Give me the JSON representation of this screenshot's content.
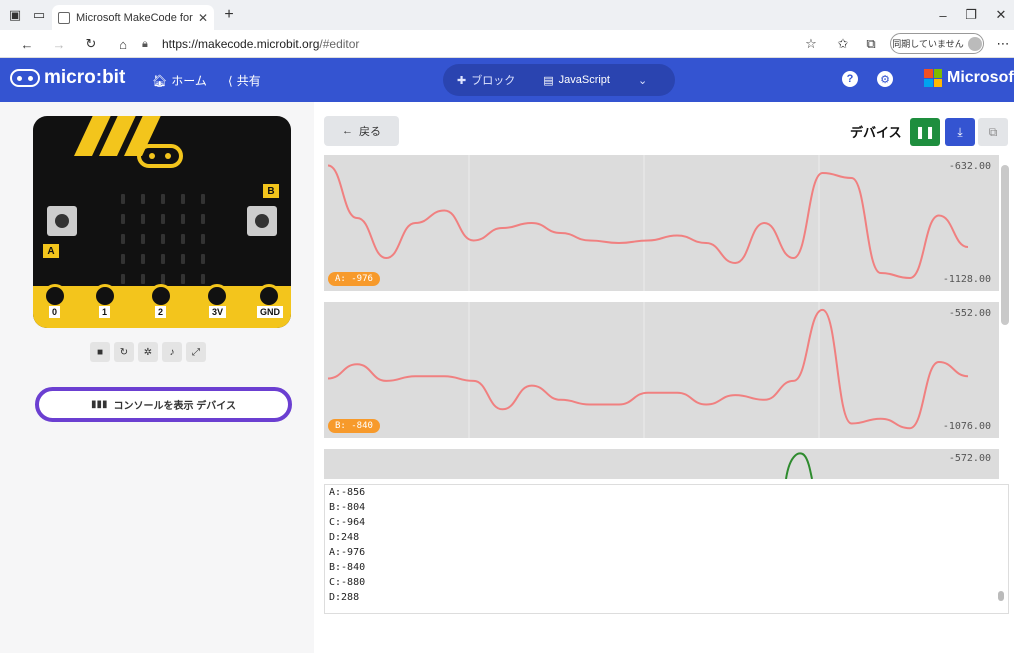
{
  "browser": {
    "tab_title": "Microsoft MakeCode for mi",
    "url_host": "https://makecode.microbit.org",
    "url_path": "/#editor",
    "sync_label": "同期していません"
  },
  "header": {
    "logo_text": "micro:bit",
    "home_label": "ホーム",
    "share_label": "共有",
    "blocks_label": "ブロック",
    "js_label": "JavaScript",
    "ms_label": "Microsoft"
  },
  "simulator": {
    "pins": [
      "0",
      "1",
      "2",
      "3V",
      "GND"
    ],
    "button_a": "A",
    "button_b": "B",
    "console_button_label": "コンソールを表示 デバイス"
  },
  "serial": {
    "back_label": "戻る",
    "device_label": "デバイス",
    "colors": {
      "series_a": "#f08080",
      "series_b": "#f08080",
      "series_c": "#2e8b2e",
      "badge": "#f79a2b"
    }
  },
  "chart_data": [
    {
      "type": "line",
      "series": [
        {
          "name": "A",
          "values": [
            -650,
            -860,
            -1020,
            -880,
            -830,
            -950,
            -900,
            -880,
            -920,
            -950,
            -960,
            -950,
            -930,
            -960,
            -1040,
            -880,
            -1020,
            -680,
            -700,
            -1080,
            -1100,
            -850,
            -976
          ]
        }
      ],
      "max_label": "-632.00",
      "min_label": "-1128.00",
      "badge": "A: -976"
    },
    {
      "type": "line",
      "series": [
        {
          "name": "B",
          "values": [
            -850,
            -790,
            -860,
            -840,
            -840,
            -860,
            -980,
            -880,
            -940,
            -960,
            -960,
            -910,
            -910,
            -960,
            -920,
            -940,
            -860,
            -560,
            -1040,
            -1020,
            -1060,
            -780,
            -840
          ]
        }
      ],
      "max_label": "-552.00",
      "min_label": "-1076.00",
      "badge": "B: -840"
    },
    {
      "type": "line",
      "series": [
        {
          "name": "C",
          "values": [
            -576,
            -580,
            -596
          ]
        }
      ],
      "max_label": "-572.00"
    }
  ],
  "console_lines": [
    "A:-856",
    "B:-804",
    "C:-964",
    "D:248",
    "A:-976",
    "B:-840",
    "C:-880",
    "D:288"
  ]
}
